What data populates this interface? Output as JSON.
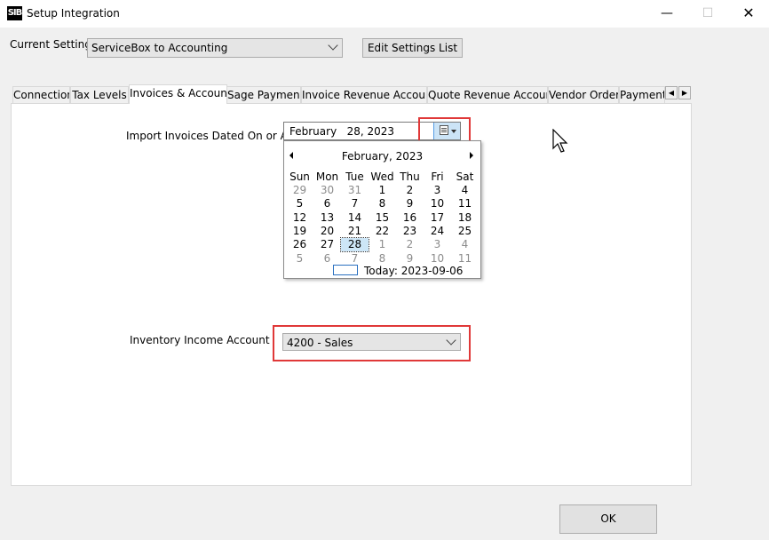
{
  "window": {
    "icon_text": "SIB",
    "title": "Setup Integration"
  },
  "settings": {
    "current_label": "Current Settings",
    "current_value": "ServiceBox to Accounting",
    "edit_button": "Edit Settings List"
  },
  "tabs": [
    {
      "label": "Connection"
    },
    {
      "label": "Tax Levels"
    },
    {
      "label": "Invoices & Accounts",
      "active": true
    },
    {
      "label": "Sage Payments"
    },
    {
      "label": "Invoice Revenue Accounts"
    },
    {
      "label": "Quote Revenue Accounts"
    },
    {
      "label": "Vendor Orders"
    },
    {
      "label": "Payment"
    }
  ],
  "import": {
    "label": "Import Invoices Dated On or After",
    "date_value": "February   28, 2023"
  },
  "calendar": {
    "month_title": "February, 2023",
    "weekdays": [
      "Sun",
      "Mon",
      "Tue",
      "Wed",
      "Thu",
      "Fri",
      "Sat"
    ],
    "weeks": [
      [
        "29",
        "30",
        "31",
        "1",
        "2",
        "3",
        "4"
      ],
      [
        "5",
        "6",
        "7",
        "8",
        "9",
        "10",
        "11"
      ],
      [
        "12",
        "13",
        "14",
        "15",
        "16",
        "17",
        "18"
      ],
      [
        "19",
        "20",
        "21",
        "22",
        "23",
        "24",
        "25"
      ],
      [
        "26",
        "27",
        "28",
        "1",
        "2",
        "3",
        "4"
      ],
      [
        "5",
        "6",
        "7",
        "8",
        "9",
        "10",
        "11"
      ]
    ],
    "selected": "28",
    "today_label": "Today: 2023-09-06"
  },
  "inventory": {
    "label": "Inventory Income Account",
    "value": "4200 - Sales"
  },
  "ok_button": "OK"
}
